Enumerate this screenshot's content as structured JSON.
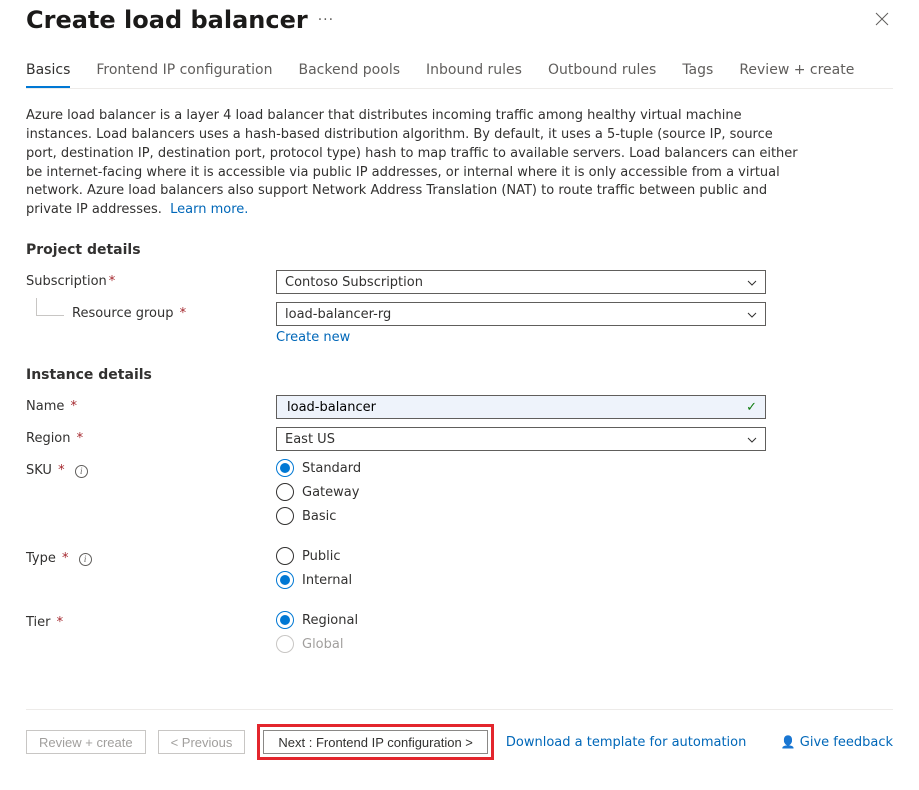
{
  "header": {
    "title": "Create load balancer"
  },
  "tabs": [
    "Basics",
    "Frontend IP configuration",
    "Backend pools",
    "Inbound rules",
    "Outbound rules",
    "Tags",
    "Review + create"
  ],
  "intro": {
    "text": "Azure load balancer is a layer 4 load balancer that distributes incoming traffic among healthy virtual machine instances. Load balancers uses a hash-based distribution algorithm. By default, it uses a 5-tuple (source IP, source port, destination IP, destination port, protocol type) hash to map traffic to available servers. Load balancers can either be internet-facing where it is accessible via public IP addresses, or internal where it is only accessible from a virtual network. Azure load balancers also support Network Address Translation (NAT) to route traffic between public and private IP addresses.",
    "learn_more": "Learn more."
  },
  "sections": {
    "project": {
      "title": "Project details",
      "subscription_label": "Subscription",
      "subscription_value": "Contoso Subscription",
      "resource_group_label": "Resource group",
      "resource_group_value": "load-balancer-rg",
      "create_new": "Create new"
    },
    "instance": {
      "title": "Instance details",
      "name_label": "Name",
      "name_value": "load-balancer",
      "region_label": "Region",
      "region_value": "East US",
      "sku_label": "SKU",
      "sku_options": {
        "standard": "Standard",
        "gateway": "Gateway",
        "basic": "Basic"
      },
      "type_label": "Type",
      "type_options": {
        "public": "Public",
        "internal": "Internal"
      },
      "tier_label": "Tier",
      "tier_options": {
        "regional": "Regional",
        "global": "Global"
      }
    }
  },
  "footer": {
    "review_create": "Review + create",
    "previous": "<  Previous",
    "next": "Next : Frontend IP configuration  >",
    "download": "Download a template for automation",
    "feedback": "Give feedback"
  }
}
